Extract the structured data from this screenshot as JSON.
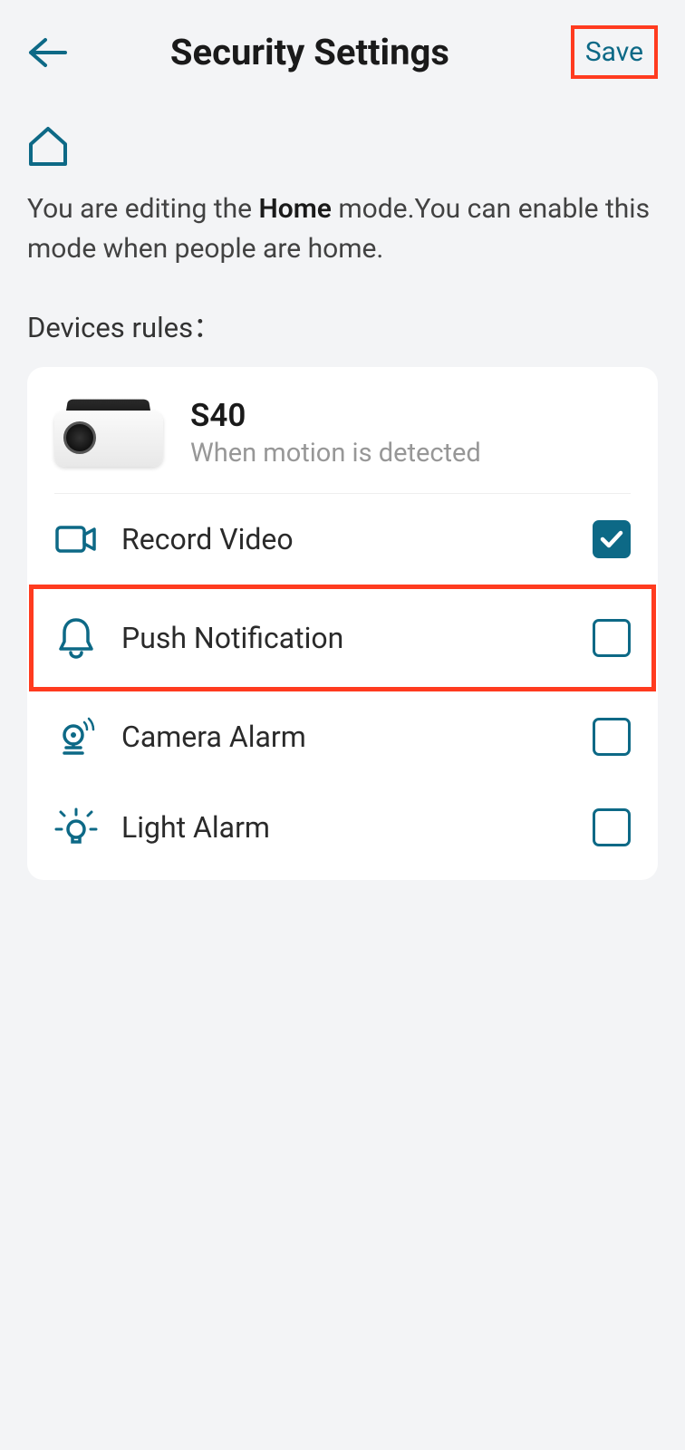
{
  "header": {
    "title": "Security Settings",
    "save_label": "Save"
  },
  "description": {
    "prefix": "You are editing the ",
    "mode": "Home",
    "suffix": " mode.You can enable this mode when people are home."
  },
  "section_title": "Devices rules：",
  "device": {
    "name": "S40",
    "subtitle": "When motion is detected"
  },
  "rules": [
    {
      "label": "Record Video",
      "checked": true,
      "icon": "video"
    },
    {
      "label": "Push Notification",
      "checked": false,
      "icon": "bell",
      "highlighted": true
    },
    {
      "label": "Camera Alarm",
      "checked": false,
      "icon": "camera-alarm"
    },
    {
      "label": "Light Alarm",
      "checked": false,
      "icon": "light"
    }
  ],
  "colors": {
    "accent": "#0d6986",
    "highlight": "#ff3b1f"
  }
}
